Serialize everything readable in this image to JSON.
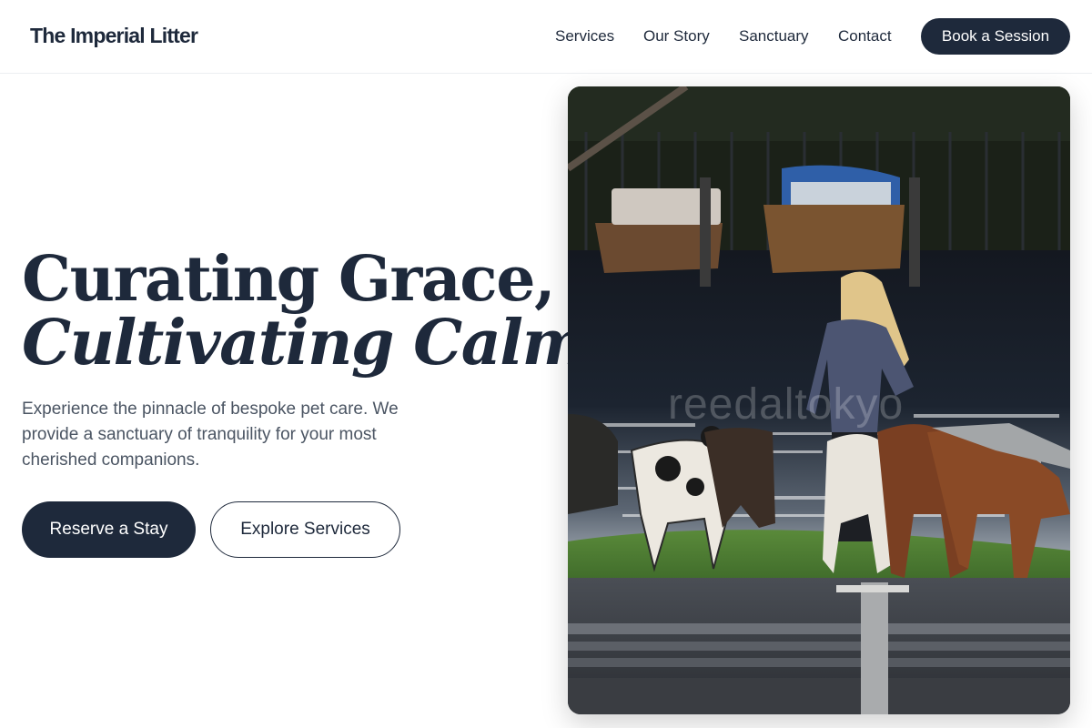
{
  "brand": {
    "name": "The Imperial Litter"
  },
  "nav": {
    "items": [
      {
        "label": "Services"
      },
      {
        "label": "Our Story"
      },
      {
        "label": "Sanctuary"
      },
      {
        "label": "Contact"
      }
    ],
    "cta": "Book a Session"
  },
  "hero": {
    "title_line1": "Curating Grace,",
    "title_line2": "Cultivating Calm.",
    "description": "Experience the pinnacle of bespoke pet care. We provide a sanctuary of tranquility for your most cherished companions.",
    "primary_button": "Reserve a Stay",
    "secondary_button": "Explore Services",
    "image_watermark": "reedaltokyo"
  },
  "colors": {
    "primary": "#1e293b",
    "text_muted": "#4b5563",
    "background": "#ffffff"
  }
}
